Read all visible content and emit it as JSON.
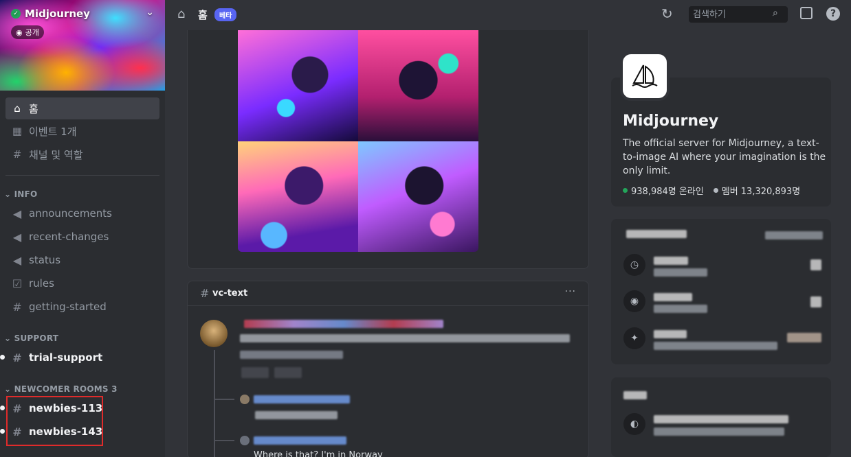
{
  "server": {
    "name": "Midjourney",
    "visibility_badge": "공개"
  },
  "sidebar": {
    "nav": [
      {
        "label": "홈",
        "icon": "home-icon",
        "active": true
      },
      {
        "label": "이벤트 1개",
        "icon": "calendar-icon"
      },
      {
        "label": "채널 및 역할",
        "icon": "channels-roles-icon"
      }
    ],
    "categories": {
      "info": "INFO",
      "support": "SUPPORT",
      "newcomer": "NEWCOMER ROOMS 3"
    },
    "info_channels": [
      {
        "name": "announcements",
        "icon": "announcement-icon"
      },
      {
        "name": "recent-changes",
        "icon": "announcement-icon"
      },
      {
        "name": "status",
        "icon": "announcement-icon"
      },
      {
        "name": "rules",
        "icon": "rules-check-icon"
      },
      {
        "name": "getting-started",
        "icon": "hash-icon"
      }
    ],
    "support_channels": [
      {
        "name": "trial-support",
        "icon": "hash-icon",
        "unread": true
      }
    ],
    "newcomer_channels": [
      {
        "name": "newbies-113",
        "icon": "thread-hash-icon",
        "unread": true
      },
      {
        "name": "newbies-143",
        "icon": "thread-hash-icon",
        "unread": true
      }
    ]
  },
  "topbar": {
    "title": "홈",
    "badge": "베타",
    "search_placeholder": "검색하기"
  },
  "feed": {
    "thread_channel": "vc-text",
    "visible_message": "Where is that? I'm in Norway"
  },
  "about": {
    "name": "Midjourney",
    "description": "The official server for Midjourney, a text-to-image AI where your imagination is the only limit.",
    "online": "938,984명 온라인",
    "members": "멤버 13,320,893명"
  },
  "colors": {
    "accent": "#5865f2",
    "online": "#23a55a",
    "highlight_box": "#e02b2b"
  }
}
